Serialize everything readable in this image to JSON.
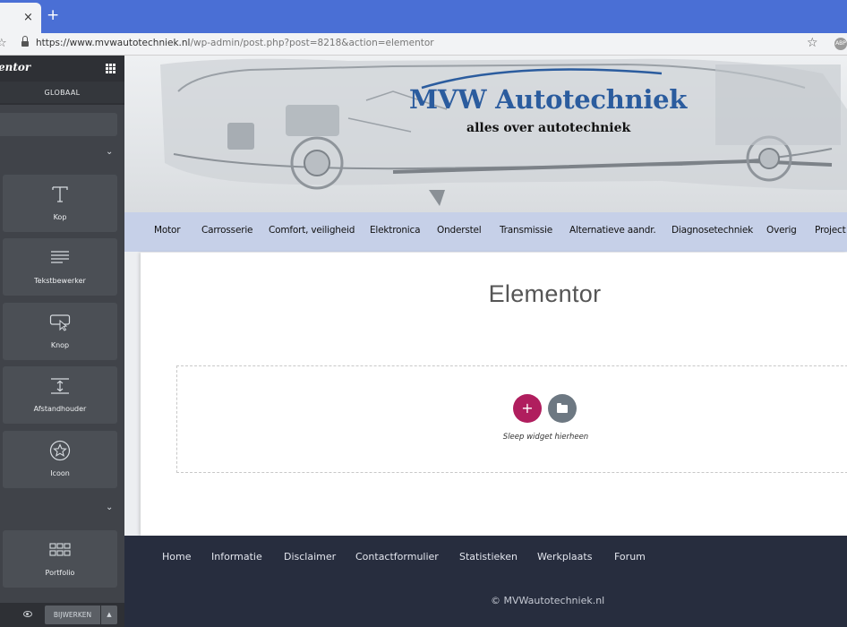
{
  "browser": {
    "tab_close": "×",
    "new_tab": "+",
    "url_host": "https://www.mvwautotechniek.nl",
    "url_path": "/wp-admin/post.php?post=8218&action=elementor",
    "bookmark_icon": "star-icon",
    "extension_badge": "ABP"
  },
  "panel": {
    "logo": "entor",
    "menu_icon": "grid-icon",
    "tab_global": "GLOBAAL",
    "widgets_group_1": [
      {
        "label": "Kop",
        "icon": "heading-icon"
      },
      {
        "label": "Tekstbewerker",
        "icon": "text-editor-icon"
      },
      {
        "label": "Knop",
        "icon": "button-icon"
      },
      {
        "label": "Afstandhouder",
        "icon": "spacer-icon"
      },
      {
        "label": "Icoon",
        "icon": "star-circle-icon"
      }
    ],
    "widgets_group_2": [
      {
        "label": "Portfolio",
        "icon": "portfolio-grid-icon"
      }
    ],
    "update_label": "BIJWERKEN",
    "update_arrow": "▲",
    "collapse": "‹"
  },
  "site": {
    "brand_title": "MVW Autotechniek",
    "brand_tagline": "alles over autotechniek",
    "nav": [
      "Motor",
      "Carrosserie",
      "Comfort, veiligheid",
      "Elektronica",
      "Onderstel",
      "Transmissie",
      "Alternatieve aandr.",
      "Diagnosetechniek",
      "Overig",
      "Project"
    ],
    "page_title": "Elementor",
    "add_section": "+",
    "drop_hint": "Sleep widget hierheen",
    "footer_links": [
      "Home",
      "Informatie",
      "Disclaimer",
      "Contactformulier",
      "Statistieken",
      "Werkplaats",
      "Forum"
    ],
    "copyright": "© MVWautotechniek.nl"
  },
  "colors": {
    "tab_strip": "#4a6fd5",
    "panel_bg": "#404349",
    "nav_bg": "#c6d0e8",
    "add_button": "#b01e5e",
    "footer_bg": "#272d3e",
    "brand_blue": "#2b5c9e"
  }
}
